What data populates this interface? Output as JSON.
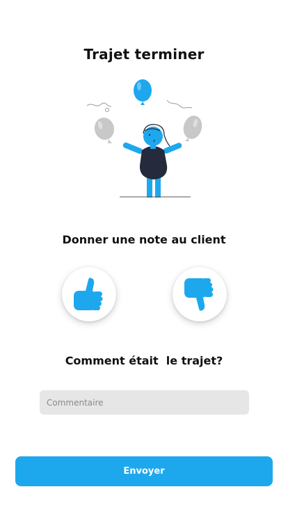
{
  "header": {
    "title": "Trajet terminer"
  },
  "rating": {
    "prompt": "Donner une note au client",
    "thumbs_up_icon": "thumbs-up-icon",
    "thumbs_down_icon": "thumbs-down-icon"
  },
  "comment": {
    "prompt": "Comment était  le trajet?",
    "placeholder": "Commentaire",
    "value": ""
  },
  "actions": {
    "submit_label": "Envoyer"
  },
  "colors": {
    "accent": "#1DA8EE",
    "dark": "#252a3c",
    "balloon_grey": "#c8c8c8",
    "input_bg": "#e6e6e6"
  }
}
